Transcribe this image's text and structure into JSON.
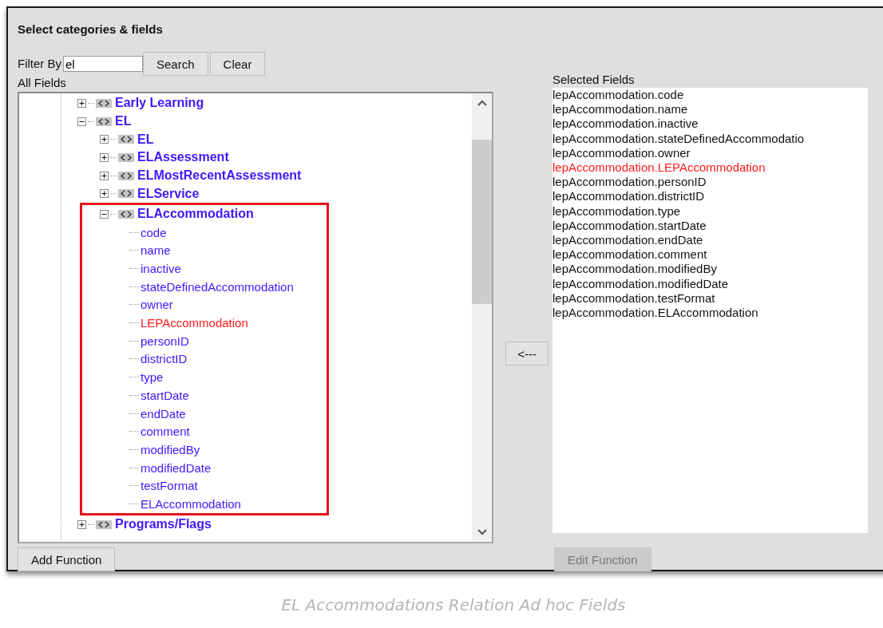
{
  "panel": {
    "title": "Select categories & fields",
    "filter": {
      "label": "Filter By",
      "value": "el"
    },
    "buttons": {
      "search": "Search",
      "clear": "Clear",
      "add_function": "Add Function",
      "move_left": "<---",
      "edit_function": "Edit Function"
    },
    "edit_function_disabled": true,
    "all_fields": {
      "label": "All Fields",
      "tree": [
        {
          "label": "Early Learning",
          "kind": "category",
          "expanded": false
        },
        {
          "label": "EL",
          "kind": "category",
          "expanded": true,
          "children": [
            {
              "label": "EL",
              "kind": "category",
              "expanded": false
            },
            {
              "label": "ELAssessment",
              "kind": "category",
              "expanded": false
            },
            {
              "label": "ELMostRecentAssessment",
              "kind": "category",
              "expanded": false
            },
            {
              "label": "ELService",
              "kind": "category",
              "expanded": false
            },
            {
              "label": "ELAccommodation",
              "kind": "category",
              "expanded": true,
              "highlighted": true,
              "children": [
                {
                  "label": "code",
                  "kind": "field",
                  "flagged": false
                },
                {
                  "label": "name",
                  "kind": "field",
                  "flagged": false
                },
                {
                  "label": "inactive",
                  "kind": "field",
                  "flagged": false
                },
                {
                  "label": "stateDefinedAccommodation",
                  "kind": "field",
                  "flagged": false
                },
                {
                  "label": "owner",
                  "kind": "field",
                  "flagged": false
                },
                {
                  "label": "LEPAccommodation",
                  "kind": "field",
                  "flagged": true
                },
                {
                  "label": "personID",
                  "kind": "field",
                  "flagged": false
                },
                {
                  "label": "districtID",
                  "kind": "field",
                  "flagged": false
                },
                {
                  "label": "type",
                  "kind": "field",
                  "flagged": false
                },
                {
                  "label": "startDate",
                  "kind": "field",
                  "flagged": false
                },
                {
                  "label": "endDate",
                  "kind": "field",
                  "flagged": false
                },
                {
                  "label": "comment",
                  "kind": "field",
                  "flagged": false
                },
                {
                  "label": "modifiedBy",
                  "kind": "field",
                  "flagged": false
                },
                {
                  "label": "modifiedDate",
                  "kind": "field",
                  "flagged": false
                },
                {
                  "label": "testFormat",
                  "kind": "field",
                  "flagged": false
                },
                {
                  "label": "ELAccommodation",
                  "kind": "field",
                  "flagged": false
                }
              ]
            }
          ]
        },
        {
          "label": "Programs/Flags",
          "kind": "category",
          "expanded": false
        }
      ]
    },
    "selected_fields": {
      "label": "Selected Fields",
      "items": [
        {
          "text": "lepAccommodation.code",
          "flagged": false
        },
        {
          "text": "lepAccommodation.name",
          "flagged": false
        },
        {
          "text": "lepAccommodation.inactive",
          "flagged": false
        },
        {
          "text": "lepAccommodation.stateDefinedAccommodatio",
          "flagged": false
        },
        {
          "text": "lepAccommodation.owner",
          "flagged": false
        },
        {
          "text": "lepAccommodation.LEPAccommodation",
          "flagged": true
        },
        {
          "text": "lepAccommodation.personID",
          "flagged": false
        },
        {
          "text": "lepAccommodation.districtID",
          "flagged": false
        },
        {
          "text": "lepAccommodation.type",
          "flagged": false
        },
        {
          "text": "lepAccommodation.startDate",
          "flagged": false
        },
        {
          "text": "lepAccommodation.endDate",
          "flagged": false
        },
        {
          "text": "lepAccommodation.comment",
          "flagged": false
        },
        {
          "text": "lepAccommodation.modifiedBy",
          "flagged": false
        },
        {
          "text": "lepAccommodation.modifiedDate",
          "flagged": false
        },
        {
          "text": "lepAccommodation.testFormat",
          "flagged": false
        },
        {
          "text": "lepAccommodation.ELAccommodation",
          "flagged": false
        }
      ]
    }
  },
  "caption": "EL Accommodations Relation Ad hoc Fields"
}
